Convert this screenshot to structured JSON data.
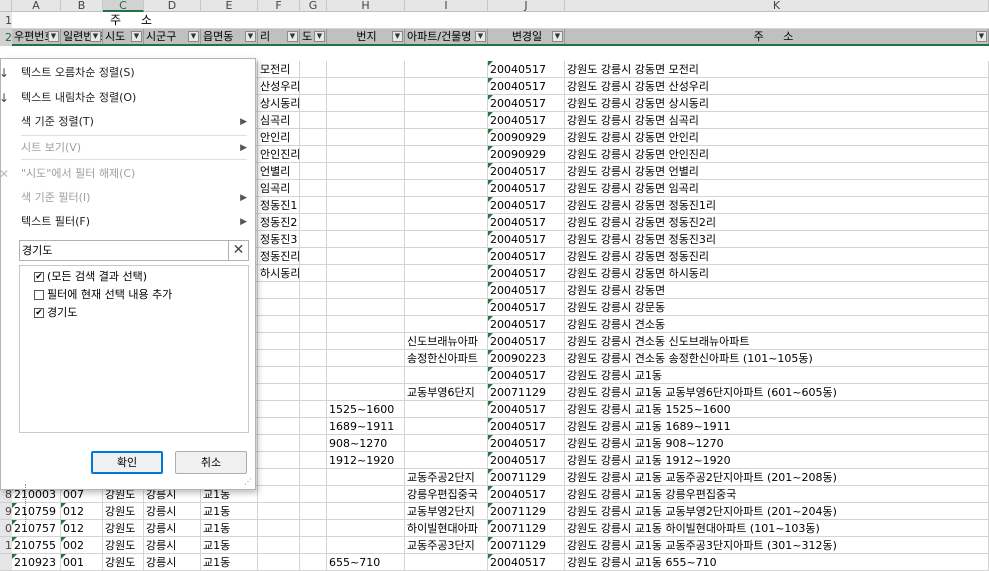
{
  "columns": [
    "A",
    "B",
    "C",
    "D",
    "E",
    "F",
    "G",
    "H",
    "I",
    "J",
    "K"
  ],
  "merged_header": {
    "address": "주 소"
  },
  "header_row": [
    "우편번호",
    "일련번호",
    "시도",
    "시군구",
    "읍면동",
    "리",
    "도",
    "번지",
    "아파트/건물명",
    "변경일",
    "주 소"
  ],
  "row_numbers_visible": [
    "1",
    "2",
    "8",
    "9",
    "0",
    "1"
  ],
  "data_rows": [
    {
      "f": "모전리",
      "h": "",
      "i": "",
      "j": "20040517",
      "k": "강원도 강릉시 강동면 모전리"
    },
    {
      "f": "산성우리",
      "h": "",
      "i": "",
      "j": "20040517",
      "k": "강원도 강릉시 강동면 산성우리"
    },
    {
      "f": "상시동리",
      "h": "",
      "i": "",
      "j": "20040517",
      "k": "강원도 강릉시 강동면 상시동리"
    },
    {
      "f": "심곡리",
      "h": "",
      "i": "",
      "j": "20040517",
      "k": "강원도 강릉시 강동면 심곡리"
    },
    {
      "f": "안인리",
      "h": "",
      "i": "",
      "j": "20090929",
      "k": "강원도 강릉시 강동면 안인리"
    },
    {
      "f": "안인진리",
      "h": "",
      "i": "",
      "j": "20090929",
      "k": "강원도 강릉시 강동면 안인진리"
    },
    {
      "f": "언별리",
      "h": "",
      "i": "",
      "j": "20040517",
      "k": "강원도 강릉시 강동면 언별리"
    },
    {
      "f": "임곡리",
      "h": "",
      "i": "",
      "j": "20040517",
      "k": "강원도 강릉시 강동면 임곡리"
    },
    {
      "f": "정동진1",
      "h": "",
      "i": "",
      "j": "20040517",
      "k": "강원도 강릉시 강동면 정동진1리"
    },
    {
      "f": "정동진2",
      "h": "",
      "i": "",
      "j": "20040517",
      "k": "강원도 강릉시 강동면 정동진2리"
    },
    {
      "f": "정동진3",
      "h": "",
      "i": "",
      "j": "20040517",
      "k": "강원도 강릉시 강동면 정동진3리"
    },
    {
      "f": "정동진리",
      "h": "",
      "i": "",
      "j": "20040517",
      "k": "강원도 강릉시 강동면 정동진리"
    },
    {
      "f": "하시동리",
      "h": "",
      "i": "",
      "j": "20040517",
      "k": "강원도 강릉시 강동면 하시동리"
    },
    {
      "f": "",
      "h": "",
      "i": "",
      "j": "20040517",
      "k": "강원도 강릉시 강동면"
    },
    {
      "f": "",
      "h": "",
      "i": "",
      "j": "20040517",
      "k": "강원도 강릉시 강문동"
    },
    {
      "f": "",
      "h": "",
      "i": "",
      "j": "20040517",
      "k": "강원도 강릉시 견소동"
    },
    {
      "f": "",
      "h": "",
      "i": "신도브래뉴아파",
      "j": "20040517",
      "k": "강원도 강릉시 견소동 신도브래뉴아파트"
    },
    {
      "f": "",
      "h": "",
      "i": "송정한신아파트",
      "j": "20090223",
      "k": "강원도 강릉시 견소동 송정한신아파트 (101~105동)"
    },
    {
      "f": "",
      "h": "",
      "i": "",
      "j": "20040517",
      "k": "강원도 강릉시 교1동"
    },
    {
      "f": "",
      "h": "",
      "i": "교동부영6단지",
      "j": "20071129",
      "k": "강원도 강릉시 교1동 교동부영6단지아파트 (601~605동)"
    },
    {
      "f": "",
      "h": "1525~1600",
      "i": "",
      "j": "20040517",
      "k": "강원도 강릉시 교1동 1525~1600"
    },
    {
      "f": "",
      "h": "1689~1911",
      "i": "",
      "j": "20040517",
      "k": "강원도 강릉시 교1동 1689~1911"
    },
    {
      "f": "",
      "h": "908~1270",
      "i": "",
      "j": "20040517",
      "k": "강원도 강릉시 교1동 908~1270"
    },
    {
      "f": "",
      "h": "1912~1920",
      "i": "",
      "j": "20040517",
      "k": "강원도 강릉시 교1동 1912~1920"
    },
    {
      "f": "",
      "h": "",
      "i": "교동주공2단지",
      "j": "20071129",
      "k": "강원도 강릉시 교1동 교동주공2단지아파트 (201~208동)"
    }
  ],
  "full_rows": [
    {
      "rn": "8",
      "a": "210003",
      "b": "007",
      "c": "강원도",
      "d": "강릉시",
      "e": "교1동",
      "h": "",
      "i": "강릉우편집중국",
      "j": "20040517",
      "k": "강원도 강릉시 교1동 강릉우편집중국"
    },
    {
      "rn": "9",
      "a": "210759",
      "b": "012",
      "c": "강원도",
      "d": "강릉시",
      "e": "교1동",
      "h": "",
      "i": "교동부영2단지",
      "j": "20071129",
      "k": "강원도 강릉시 교1동 교동부영2단지아파트 (201~204동)"
    },
    {
      "rn": "0",
      "a": "210757",
      "b": "012",
      "c": "강원도",
      "d": "강릉시",
      "e": "교1동",
      "h": "",
      "i": "하이빌현대아파",
      "j": "20071129",
      "k": "강원도 강릉시 교1동 하이빌현대아파트 (101~103동)"
    },
    {
      "rn": "1",
      "a": "210755",
      "b": "002",
      "c": "강원도",
      "d": "강릉시",
      "e": "교1동",
      "h": "",
      "i": "교동주공3단지",
      "j": "20071129",
      "k": "강원도 강릉시 교1동 교동주공3단지아파트 (301~312동)"
    },
    {
      "rn": "",
      "a": "210923",
      "b": "001",
      "c": "강원도",
      "d": "강릉시",
      "e": "교1동",
      "h": "655~710",
      "i": "",
      "j": "20040517",
      "k": "강원도 강릉시 교1동 655~710"
    }
  ],
  "filter_menu": {
    "sort_asc": "텍스트 오름차순 정렬(S)",
    "sort_desc": "텍스트 내림차순 정렬(O)",
    "sort_by_color": "색 기준 정렬(T)",
    "sheet_view": "시트 보기(V)",
    "clear_filter": "\"시도\"에서 필터 해제(C)",
    "filter_by_color": "색 기준 필터(I)",
    "text_filter": "텍스트 필터(F)",
    "search_value": "경기도",
    "list_items": [
      {
        "label": "(모든 검색 결과 선택)",
        "checked": true
      },
      {
        "label": "필터에 현재 선택 내용 추가",
        "checked": false
      },
      {
        "label": "경기도",
        "checked": true
      }
    ],
    "ok_label": "확인",
    "cancel_label": "취소"
  }
}
